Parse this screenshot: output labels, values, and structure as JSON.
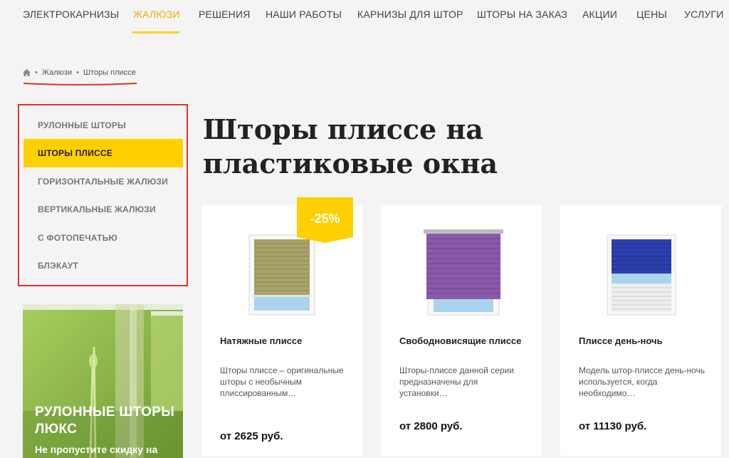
{
  "nav": {
    "items": [
      "ЭЛЕКТРОКАРНИЗЫ",
      "ЖАЛЮЗИ",
      "РЕШЕНИЯ",
      "НАШИ РАБОТЫ",
      "КАРНИЗЫ ДЛЯ ШТОР",
      "ШТОРЫ НА ЗАКАЗ",
      "АКЦИИ",
      "ЦЕНЫ",
      "УСЛУГИ"
    ],
    "active": "ЖАЛЮЗИ"
  },
  "breadcrumb": {
    "home_icon": "home-icon",
    "items": [
      "Жалюзи",
      "Шторы плиссе"
    ],
    "separator": "•"
  },
  "sidebar": {
    "items": [
      "РУЛОННЫЕ ШТОРЫ",
      "ШТОРЫ ПЛИССЕ",
      "ГОРИЗОНТАЛЬНЫЕ ЖАЛЮЗИ",
      "ВЕРТИКАЛЬНЫЕ ЖАЛЮЗИ",
      "С ФОТОПЕЧАТЬЮ",
      "БЛЭКАУТ"
    ],
    "active": "ШТОРЫ ПЛИССЕ"
  },
  "promo": {
    "title": "РУЛОННЫЕ ШТОРЫ ЛЮКС",
    "subtitle": "Не пропустите скидку на"
  },
  "page": {
    "title": "Шторы плиссе на пластиковые окна"
  },
  "products": [
    {
      "name": "Натяжные плиссе",
      "description": "Шторы плиссе – оригинальные шторы с необычным плиссированным…",
      "price": "от 2625 руб.",
      "badge": "-25%",
      "color": "#a7a36a"
    },
    {
      "name": "Свободновисящие плиссе",
      "description": "Шторы-плиссе данной серии предназначены для установки…",
      "price": "от 2800 руб.",
      "color": "#8a5aa8"
    },
    {
      "name": "Плиссе день-ночь",
      "description": "Модель штор-плиссе день-ночь используется, когда необходимо…",
      "price": "от 11130 руб.",
      "color": "#2c3fae"
    }
  ],
  "colors": {
    "accent": "#ffd000",
    "highlight": "#e4322b"
  }
}
